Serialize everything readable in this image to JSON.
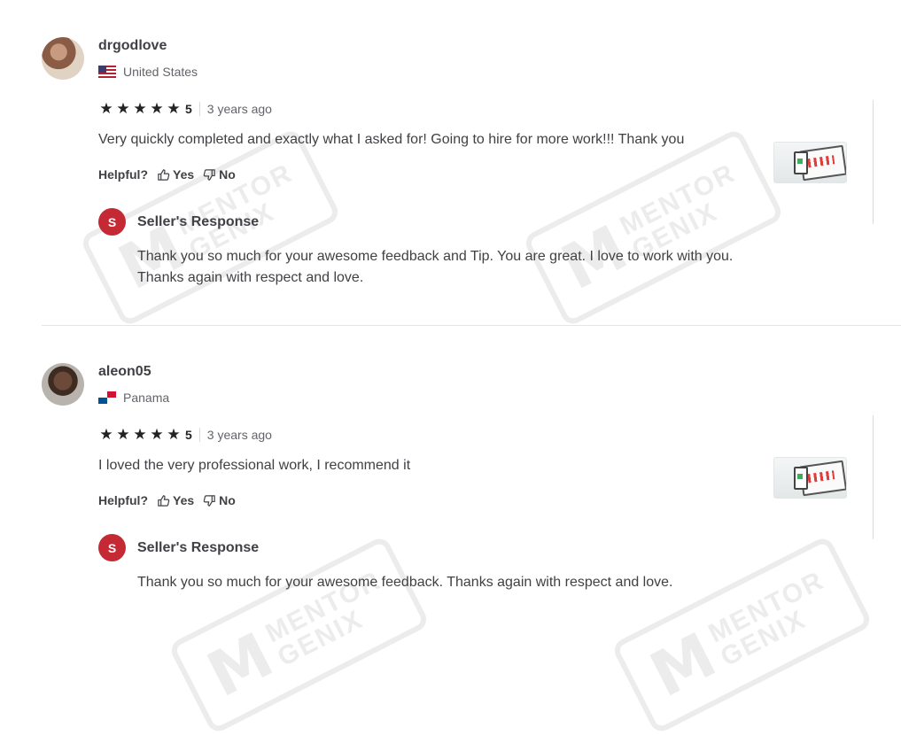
{
  "watermark": {
    "mark": "M",
    "line1": "MENTOR",
    "line2": "GENIX"
  },
  "labels": {
    "helpful": "Helpful?",
    "yes": "Yes",
    "no": "No",
    "seller_response": "Seller's Response",
    "seller_initial": "S"
  },
  "reviews": [
    {
      "username": "drgodlove",
      "country": "United States",
      "flag": "us-flag-icon",
      "rating": "5",
      "time": "3 years ago",
      "text": "Very quickly completed and exactly what I asked for! Going to hire for more work!!! Thank you",
      "seller_response": "Thank you so much for your awesome feedback and Tip. You are great. I love to work with you. Thanks again with respect and love."
    },
    {
      "username": "aleon05",
      "country": "Panama",
      "flag": "panama-flag-icon",
      "rating": "5",
      "time": "3 years ago",
      "text": "I loved the very professional work, I recommend it",
      "seller_response": "Thank you so much for your awesome feedback. Thanks again with respect and love."
    }
  ],
  "colors": {
    "star": "#222325",
    "seller_badge": "#c52a34",
    "text": "#404145",
    "muted": "#62646a"
  }
}
